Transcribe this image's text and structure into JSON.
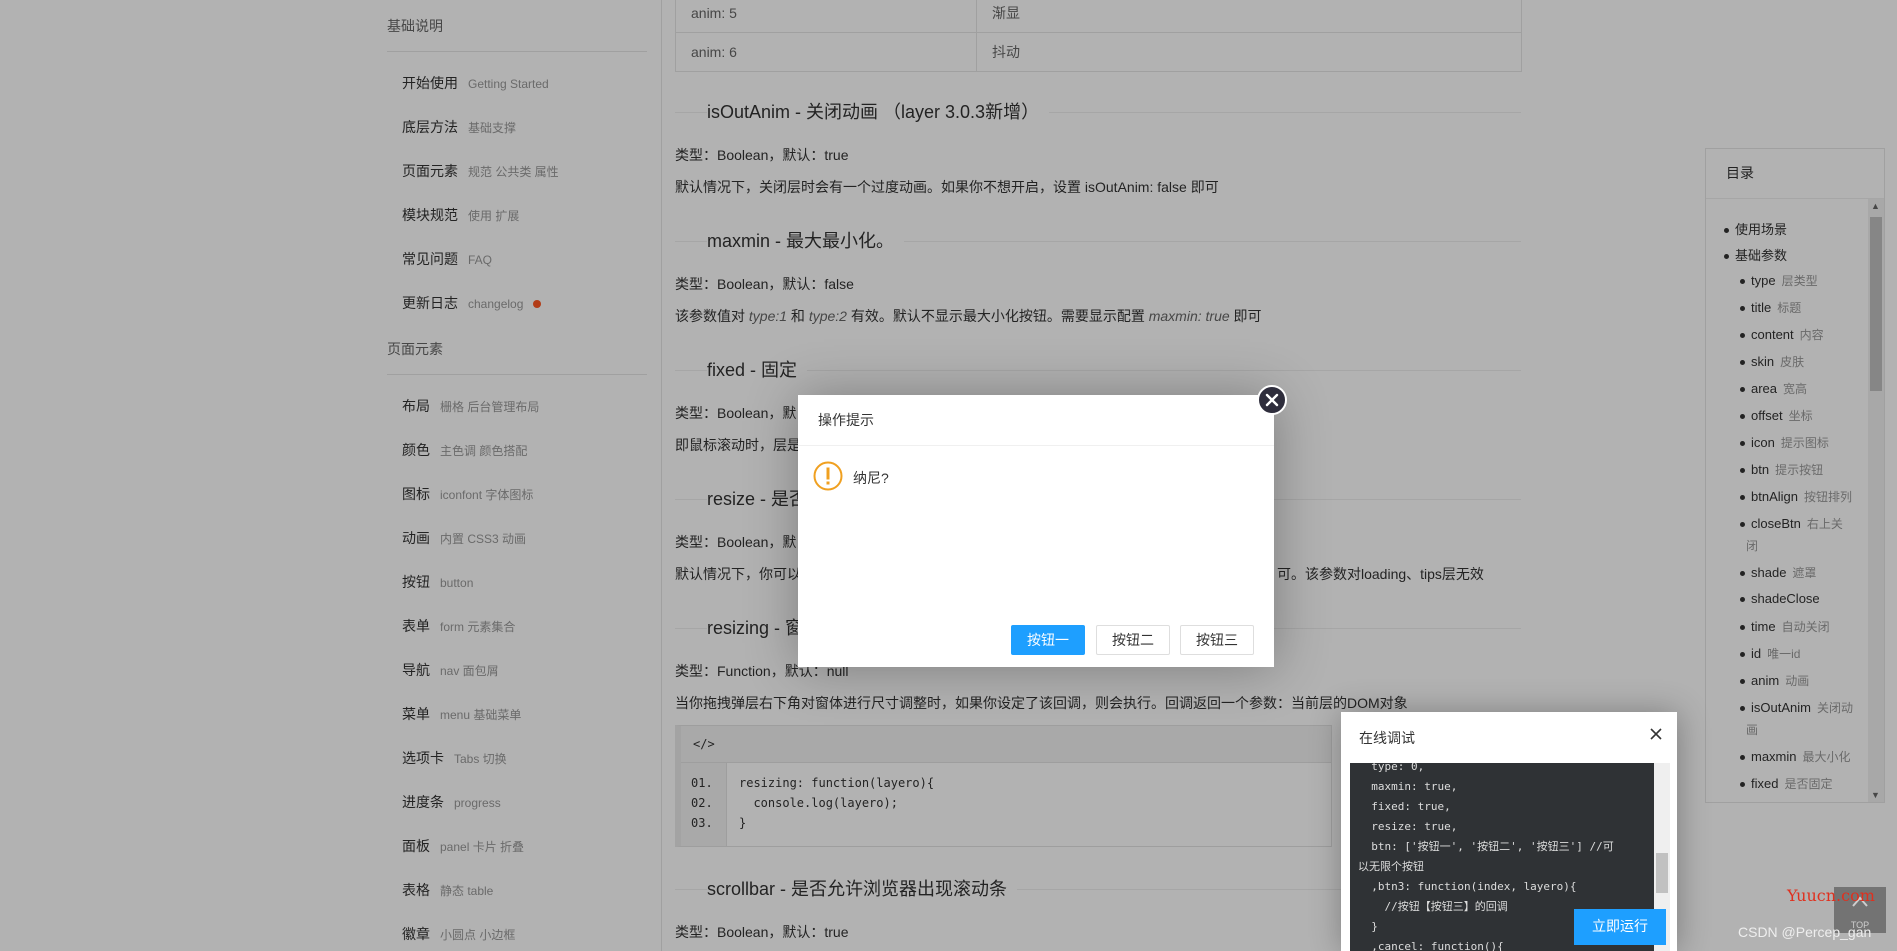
{
  "sidebar": {
    "group1": "基础说明",
    "group1_items": [
      {
        "cn": "开始使用",
        "en": "Getting Started"
      },
      {
        "cn": "底层方法",
        "en": "基础支撑"
      },
      {
        "cn": "页面元素",
        "en": "规范 公共类 属性"
      },
      {
        "cn": "模块规范",
        "en": "使用 扩展"
      },
      {
        "cn": "常见问题",
        "en": "FAQ"
      },
      {
        "cn": "更新日志",
        "en": "changelog"
      }
    ],
    "group2": "页面元素",
    "group2_items": [
      {
        "cn": "布局",
        "en": "栅格 后台管理布局"
      },
      {
        "cn": "颜色",
        "en": "主色调 颜色搭配"
      },
      {
        "cn": "图标",
        "en": "iconfont 字体图标"
      },
      {
        "cn": "动画",
        "en": "内置 CSS3 动画"
      },
      {
        "cn": "按钮",
        "en": "button"
      },
      {
        "cn": "表单",
        "en": "form 元素集合"
      },
      {
        "cn": "导航",
        "en": "nav 面包屑"
      },
      {
        "cn": "菜单",
        "en": "menu 基础菜单"
      },
      {
        "cn": "选项卡",
        "en": "Tabs 切换"
      },
      {
        "cn": "进度条",
        "en": "progress"
      },
      {
        "cn": "面板",
        "en": "panel 卡片 折叠"
      },
      {
        "cn": "表格",
        "en": "静态 table"
      },
      {
        "cn": "徽章",
        "en": "小圆点 小边框"
      }
    ]
  },
  "anim_table": [
    {
      "key": "anim: 5",
      "val": "渐显"
    },
    {
      "key": "anim: 6",
      "val": "抖动"
    }
  ],
  "sections": {
    "isOutAnim": {
      "title": "isOutAnim - 关闭动画 （layer 3.0.3新增）",
      "type": "类型：Boolean，默认：true",
      "desc": "默认情况下，关闭层时会有一个过度动画。如果你不想开启，设置 isOutAnim: false 即可"
    },
    "maxmin": {
      "title": "maxmin - 最大最小化。",
      "type": "类型：Boolean，默认：false",
      "desc_a": "该参数值对 ",
      "desc_b": "type:1",
      "desc_c": " 和 ",
      "desc_d": "type:2",
      "desc_e": " 有效。默认不显示最大小化按钮。需要显示配置 ",
      "desc_f": "maxmin: true",
      "desc_g": " 即可"
    },
    "fixed": {
      "title": "fixed - 固定",
      "type": "类型：Boolean，默",
      "desc": "即鼠标滚动时，层是"
    },
    "resize": {
      "title": "resize - 是否",
      "type": "类型：Boolean，默",
      "desc": "默认情况下，你可以",
      "desc_tail": "可。该参数对loading、tips层无效"
    },
    "resizing": {
      "title": "resizing - 窗",
      "type": "类型：Function，默认：null",
      "desc": "当你拖拽弹层右下角对窗体进行尺寸调整时，如果你设定了该回调，则会执行。回调返回一个参数：当前层的DOM对象"
    },
    "scrollbar": {
      "title": "scrollbar - 是否允许浏览器出现滚动条",
      "type": "类型：Boolean，默认：true"
    }
  },
  "code_block": {
    "header": "</>",
    "lines": [
      {
        "num": "01.",
        "code": "resizing: function(layero){"
      },
      {
        "num": "02.",
        "code": "  console.log(layero);"
      },
      {
        "num": "03.",
        "code": "}"
      }
    ]
  },
  "toc": {
    "title": "目录",
    "items": [
      {
        "name": "使用场景",
        "sub": ""
      },
      {
        "name": "基础参数",
        "sub": ""
      },
      {
        "name": "type",
        "sub": "层类型"
      },
      {
        "name": "title",
        "sub": "标题"
      },
      {
        "name": "content",
        "sub": "内容"
      },
      {
        "name": "skin",
        "sub": "皮肤"
      },
      {
        "name": "area",
        "sub": "宽高"
      },
      {
        "name": "offset",
        "sub": "坐标"
      },
      {
        "name": "icon",
        "sub": "提示图标"
      },
      {
        "name": "btn",
        "sub": "提示按钮"
      },
      {
        "name": "btnAlign",
        "sub": "按钮排列"
      },
      {
        "name": "closeBtn",
        "sub": "右上关"
      },
      {
        "name": "",
        "sub": "闭"
      },
      {
        "name": "shade",
        "sub": "遮罩"
      },
      {
        "name": "shadeClose",
        "sub": ""
      },
      {
        "name": "time",
        "sub": "自动关闭"
      },
      {
        "name": "id",
        "sub": "唯一id"
      },
      {
        "name": "anim",
        "sub": "动画"
      },
      {
        "name": "isOutAnim",
        "sub": "关闭动"
      },
      {
        "name": "",
        "sub": "画"
      },
      {
        "name": "maxmin",
        "sub": "最大小化"
      },
      {
        "name": "fixed",
        "sub": "是否固定"
      }
    ]
  },
  "dialog": {
    "title": "操作提示",
    "message": "纳尼?",
    "btn1": "按钮一",
    "btn2": "按钮二",
    "btn3": "按钮三"
  },
  "debug_panel": {
    "title": "在线调试",
    "run_label": "立即运行",
    "lines": [
      "  type: 0,",
      "  maxmin: true,",
      "  fixed: true,",
      "  resize: true,",
      "  btn: ['按钮一', '按钮二', '按钮三'] //可",
      "以无限个按钮",
      "  ,btn3: function(index, layero){",
      "    //按钮【按钮三】的回调",
      "  }",
      "  ,cancel: function(){"
    ]
  },
  "watermark": {
    "site": "Yuucn.com",
    "author": "CSDN @Percep_gan",
    "top_label": "TOP"
  },
  "colors": {
    "primary": "#1E9FFF",
    "changelog_dot": "#FF5722",
    "warn_icon": "#F0A020"
  }
}
